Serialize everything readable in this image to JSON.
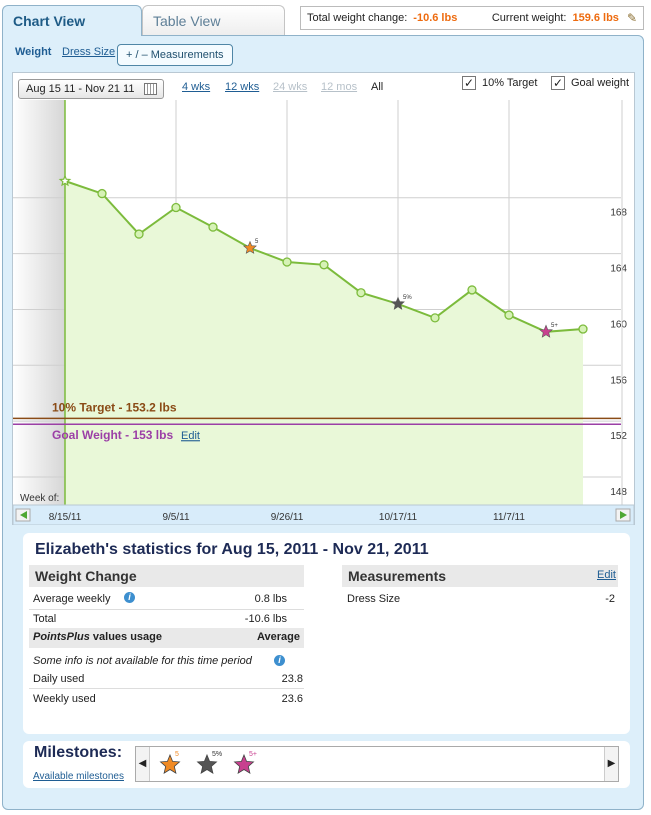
{
  "tabs": {
    "chart_view": "Chart View",
    "table_view": "Table View"
  },
  "summary": {
    "total_label": "Total weight change:",
    "total_value": "-10.6 lbs",
    "current_label": "Current weight:",
    "current_value": "159.6 lbs"
  },
  "subtabs": {
    "weight": "Weight",
    "dress_size": "Dress Size",
    "measurements": "+ / –  Measurements"
  },
  "range": {
    "date_range": "Aug 15 11 - Nov 21 11",
    "options": [
      "4 wks",
      "12 wks",
      "24 wks",
      "12 mos",
      "All"
    ]
  },
  "toggles": {
    "target": "10% Target",
    "goal": "Goal weight"
  },
  "chart_data": {
    "type": "line",
    "x_tick_labels": [
      "8/15/11",
      "9/5/11",
      "9/26/11",
      "10/17/11",
      "11/7/11"
    ],
    "y_tick_labels": [
      "168",
      "164",
      "160",
      "156",
      "152",
      "148"
    ],
    "ylim": [
      147,
      176
    ],
    "x_week_index": [
      0,
      1,
      2,
      3,
      4,
      5,
      6,
      7,
      8,
      9,
      10,
      11,
      12,
      13,
      14
    ],
    "weights": [
      170.2,
      169.3,
      166.4,
      168.3,
      166.9,
      165.4,
      164.4,
      164.2,
      162.2,
      161.4,
      160.4,
      162.4,
      160.6,
      159.4,
      159.6
    ],
    "target": 153.2,
    "goal": 153,
    "week_of_label": "Week of:",
    "target_label": "10% Target - 153.2 lbs",
    "goal_label": "Goal Weight - 153 lbs",
    "goal_edit": "Edit",
    "milestone_markers": [
      {
        "week_index": 5,
        "label": "5",
        "color": "#f08a24"
      },
      {
        "week_index": 9,
        "label": "5%",
        "color": "#555555"
      },
      {
        "week_index": 13,
        "label": "5+",
        "color": "#c8408f"
      }
    ]
  },
  "stats": {
    "title": "Elizabeth's statistics for Aug 15, 2011 - Nov 21, 2011",
    "weight_change": {
      "heading": "Weight Change",
      "avg_label": "Average weekly",
      "avg_value": "0.8  lbs",
      "total_label": "Total",
      "total_value": "-10.6  lbs"
    },
    "points": {
      "heading_brand": "PointsPlus",
      "heading_rest": " values usage",
      "heading_right": "Average",
      "note": "Some info is not available for this time period",
      "daily_label": "Daily used",
      "daily_value": "23.8",
      "weekly_label": "Weekly used",
      "weekly_value": "23.6"
    },
    "measurements": {
      "heading": "Measurements",
      "edit": "Edit",
      "dress_label": "Dress Size",
      "dress_value": "-2"
    }
  },
  "milestones": {
    "heading": "Milestones:",
    "link": "Available milestones",
    "items": [
      {
        "label": "5",
        "color": "#f08a24"
      },
      {
        "label": "5%",
        "color": "#555555"
      },
      {
        "label": "5+",
        "color": "#c8408f"
      }
    ]
  },
  "colors": {
    "accent_orange": "#ee6b0f",
    "line_green": "#7cbb3c",
    "fill_green": "#e9f8d8",
    "target_brown": "#8a4b16",
    "goal_purple": "#9b3fa6"
  }
}
